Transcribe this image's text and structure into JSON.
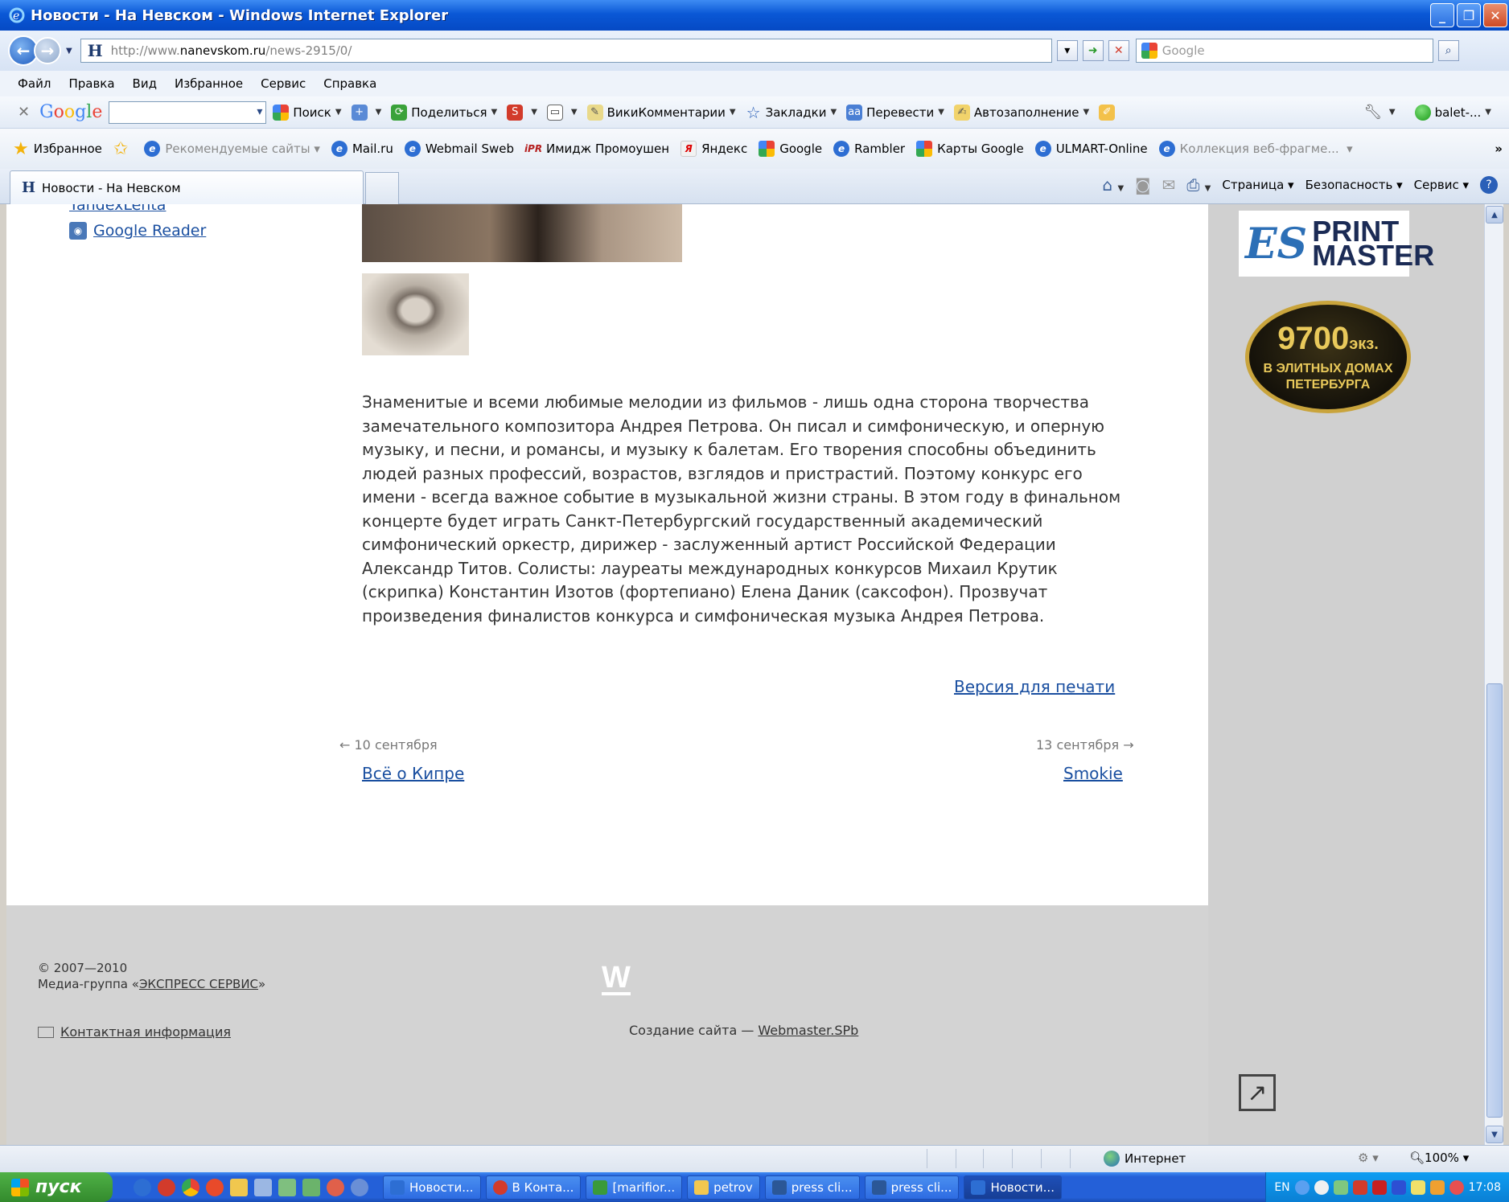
{
  "window": {
    "title": "Новости - На Невском - Windows Internet Explorer"
  },
  "address": {
    "url_prefix": "http://www.",
    "url_host": "nanevskom.ru",
    "url_path": "/news-2915/0/",
    "search_placeholder": "Google"
  },
  "menu": [
    "Файл",
    "Правка",
    "Вид",
    "Избранное",
    "Сервис",
    "Справка"
  ],
  "google_toolbar": {
    "logo": [
      "G",
      "o",
      "o",
      "g",
      "l",
      "e"
    ],
    "search": "Поиск",
    "share": "Поделиться",
    "wiki": "ВикиКомментарии",
    "bookmarks": "Закладки",
    "translate": "Перевести",
    "autofill": "Автозаполнение",
    "account": "balet-..."
  },
  "favorites": {
    "label": "Избранное",
    "items": [
      {
        "label": "Рекомендуемые сайты",
        "gray": true
      },
      {
        "label": "Mail.ru"
      },
      {
        "label": "Webmail Sweb"
      },
      {
        "label": "Имидж Промоушен"
      },
      {
        "label": "Яндекс"
      },
      {
        "label": "Google"
      },
      {
        "label": "Rambler"
      },
      {
        "label": "Карты Google"
      },
      {
        "label": "ULMART-Online"
      },
      {
        "label": "Коллекция веб-фрагме...",
        "gray": true
      }
    ]
  },
  "tabs": {
    "active_label": "Новости - На Невском",
    "cmd": {
      "page": "Страница",
      "security": "Безопасность",
      "service": "Сервис"
    }
  },
  "page": {
    "left_partial_link": "YandexLenta",
    "left_link": "Google Reader",
    "article": "Знаменитые и всеми любимые мелодии из фильмов - лишь одна сторона творчества замечательного композитора Андрея Петрова. Он писал и симфоническую, и оперную музыку, и песни, и романсы, и музыку к балетам. Его творения способны объединить людей разных профессий, возрастов, взглядов и пристрастий. Поэтому конкурс его имени - всегда важное событие в музыкальной жизни страны. В этом году в финальном концерте будет играть Санкт-Петербургский государственный академический симфонический оркестр, дирижер - заслуженный артист Российской Федерации Александр Титов. Солисты: лауреаты международных конкурсов Михаил Крутик (скрипка) Константин Изотов (фортепиано) Елена Даник (саксофон). Прозвучат произведения финалистов конкурса и симфоническая музыка Андрея Петрова.",
    "print_link": "Версия для печати",
    "prev_date": "← 10 сентября",
    "next_date": "13 сентября →",
    "prev_title": "Всё о Кипре",
    "next_title": "Smokie"
  },
  "ads": {
    "print_master_es": "ES",
    "print_master_line1": "PRINT",
    "print_master_line2": "MASTER",
    "badge_number": "9700",
    "badge_unit": "экз.",
    "badge_line1": "В ЭЛИТНЫХ ДОМАХ",
    "badge_line2": "ПЕТЕРБУРГА"
  },
  "footer": {
    "copyright_years": "© 2007—2010",
    "media_group_prefix": "Медиа-группа «",
    "media_group_link": "ЭКСПРЕСС СЕРВИС",
    "media_group_suffix": "»",
    "contact": "Контактная информация",
    "w_logo": "W",
    "created_prefix": "Создание сайта — ",
    "created_link": "Webmaster.SPb"
  },
  "status": {
    "zone": "Интернет",
    "zoom": "100%"
  },
  "taskbar": {
    "start": "пуск",
    "buttons": [
      {
        "label": "Новости...",
        "active": false,
        "color": "#2d6ed3"
      },
      {
        "label": "В Конта...",
        "active": false,
        "color": "#d23b2b"
      },
      {
        "label": "[marifior...",
        "active": false,
        "color": "#3a9a3a"
      },
      {
        "label": "petrov",
        "active": false,
        "color": "#f3c74f"
      },
      {
        "label": "press cli...",
        "active": false,
        "color": "#2b5797"
      },
      {
        "label": "press cli...",
        "active": false,
        "color": "#2b5797"
      },
      {
        "label": "Новости...",
        "active": true,
        "color": "#2d6ed3"
      }
    ],
    "lang": "EN",
    "clock": "17:08"
  }
}
